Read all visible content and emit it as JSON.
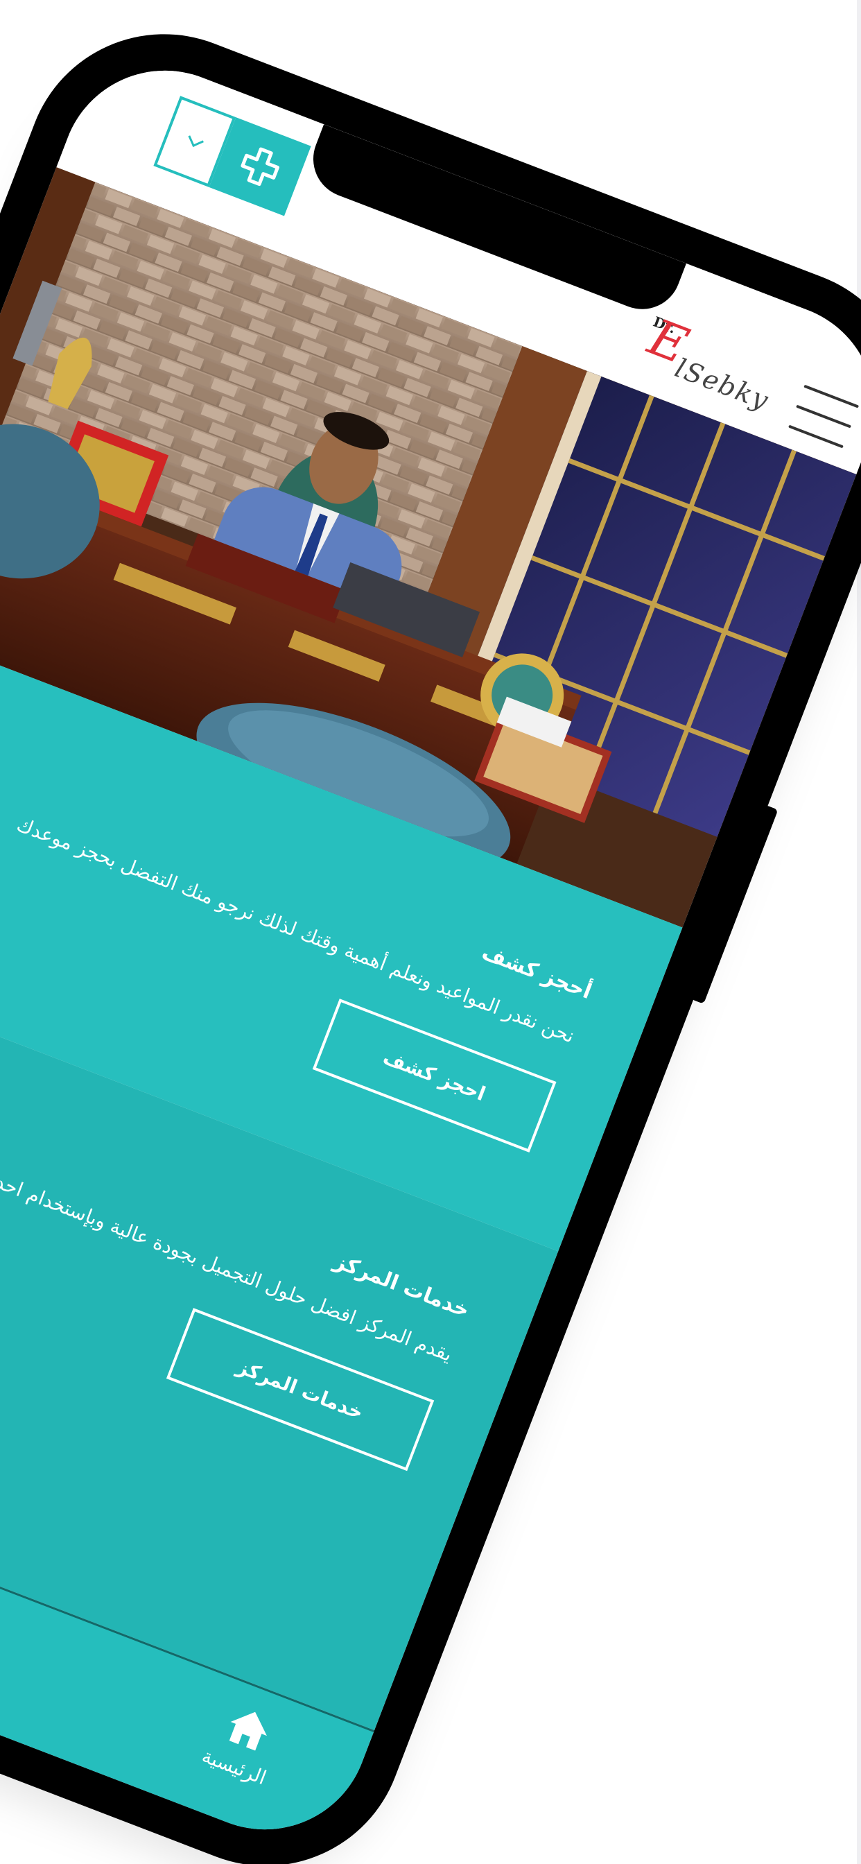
{
  "header": {
    "logo": {
      "prefix": "Dr.",
      "initial": "E",
      "name": "lSebky"
    }
  },
  "booking": {
    "title": "أحجز كشف",
    "description": "نحن نقدر المواعيد ونعلم أهمية وقتك لذلك نرجو منك التفضل بحجز موعدك",
    "button_label": "احجز كشف"
  },
  "services": {
    "title": "خدمات المركز",
    "description": "يقدم المركز افضل حلول التجميل بجودة عالية وبإستخدام احدث التقنيات",
    "button_label": "خدمات المركز"
  },
  "bottom_nav": {
    "home_label": "الرئيسية"
  },
  "colors": {
    "brand_teal": "#25bebd",
    "teal_dark": "#23b5b4",
    "logo_red": "#e0313b"
  },
  "icons": {
    "dropdown": "chevron-down-icon",
    "clinic": "medical-cross-icon",
    "menu": "hamburger-icon",
    "home": "home-icon"
  }
}
